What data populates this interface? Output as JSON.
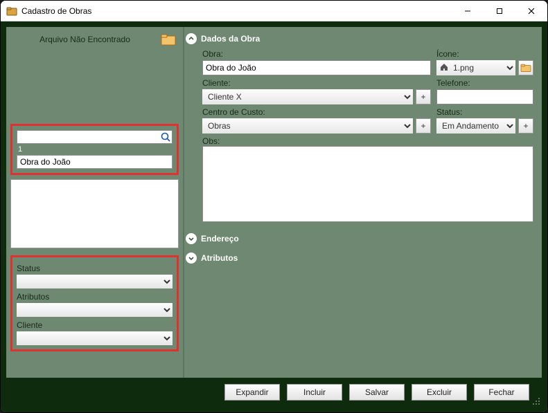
{
  "window": {
    "title": "Cadastro de Obras"
  },
  "left": {
    "file_not_found": "Arquivo Não Encontrado",
    "search_value": "",
    "result_count": "1",
    "selected_item": "Obra do João",
    "filters": {
      "status_label": "Status",
      "status_value": "",
      "atributos_label": "Atributos",
      "atributos_value": "",
      "cliente_label": "Cliente",
      "cliente_value": ""
    }
  },
  "sections": {
    "dados": {
      "title": "Dados da Obra",
      "obra_label": "Obra:",
      "obra_value": "Obra do João",
      "icone_label": "Ícone:",
      "icone_value": "1.png",
      "cliente_label": "Cliente:",
      "cliente_value": "Cliente X",
      "telefone_label": "Telefone:",
      "telefone_value": "",
      "centro_label": "Centro de Custo:",
      "centro_value": "Obras",
      "status_label": "Status:",
      "status_value": "Em Andamento",
      "obs_label": "Obs:",
      "obs_value": ""
    },
    "endereco": {
      "title": "Endereço"
    },
    "atributos": {
      "title": "Atributos"
    }
  },
  "footer": {
    "expandir": "Expandir",
    "incluir": "Incluir",
    "salvar": "Salvar",
    "excluir": "Excluir",
    "fechar": "Fechar"
  },
  "icons": {
    "plus": "+"
  }
}
